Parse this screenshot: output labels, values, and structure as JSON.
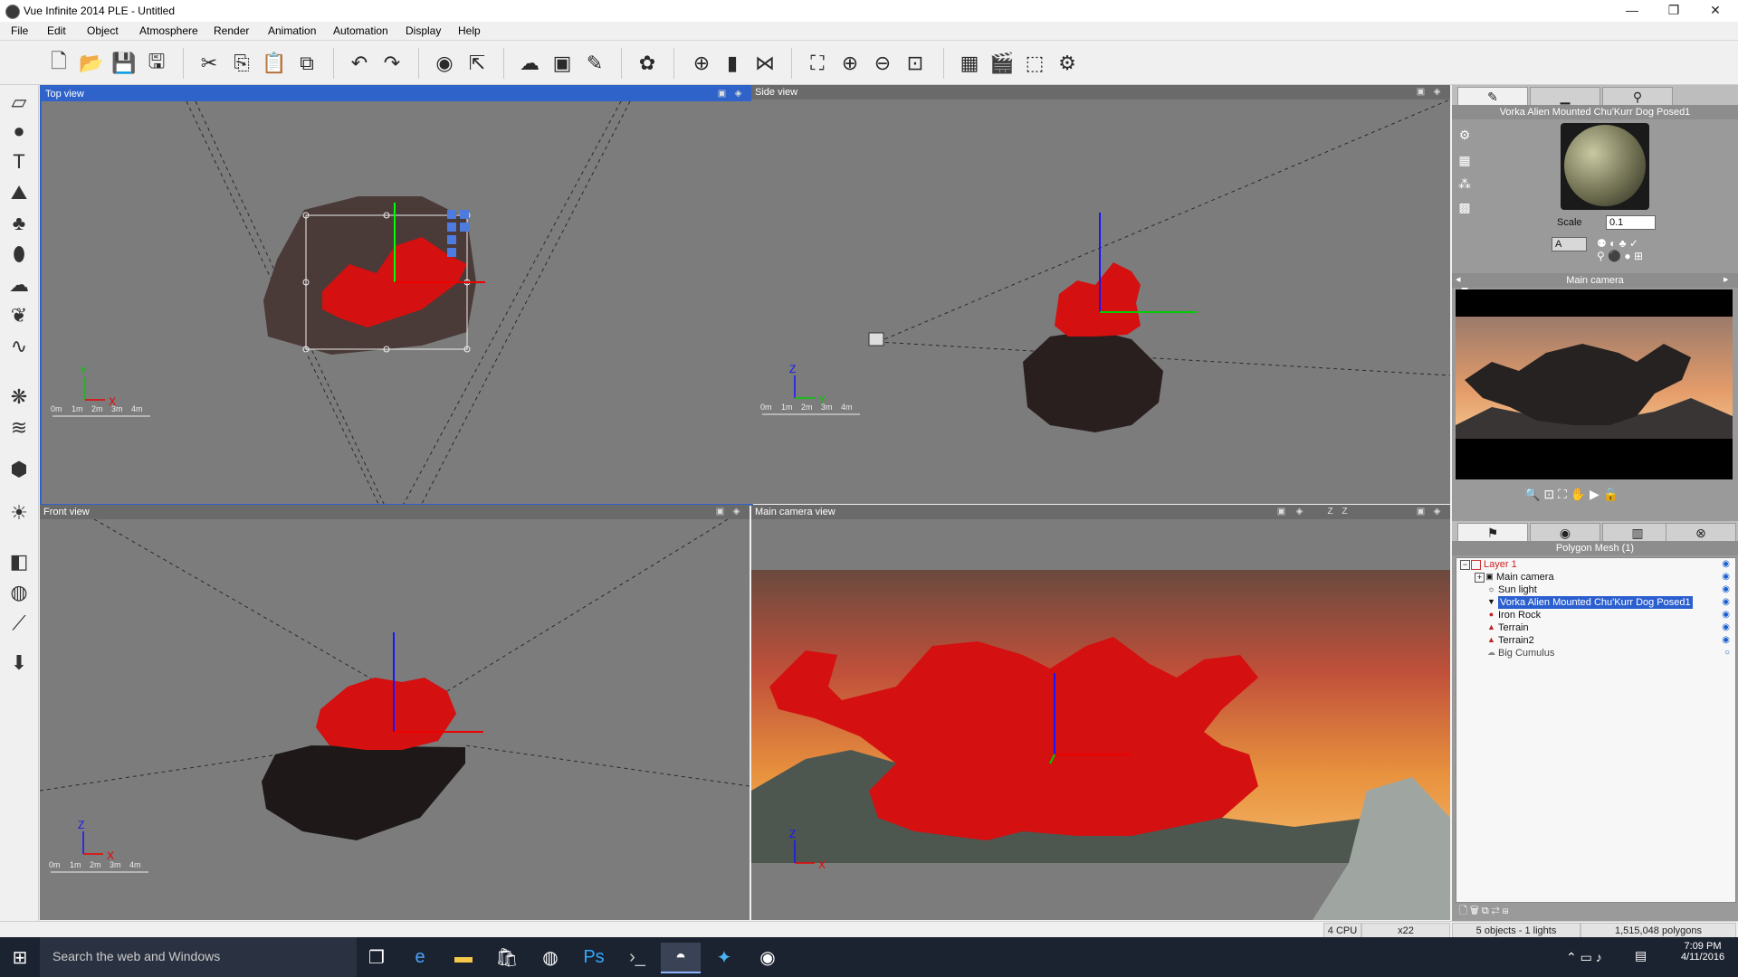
{
  "window": {
    "title": "Vue Infinite 2014 PLE - Untitled",
    "controls": [
      "—",
      "❐",
      "✕"
    ]
  },
  "menu": [
    "File",
    "Edit",
    "Object",
    "Atmosphere",
    "Render",
    "Animation",
    "Automation",
    "Display",
    "Help"
  ],
  "toolbar_icons": [
    "new-icon",
    "open-icon",
    "save-icon",
    "save-as-icon",
    "cut-icon",
    "copy-icon",
    "paste-icon",
    "duplicate-icon",
    "undo-icon",
    "redo-icon",
    "select-icon",
    "select-by-icon",
    "atmosphere-icon",
    "material-icon",
    "object-editor-icon",
    "color-icon",
    "link-icon",
    "chart-icon",
    "mirror-icon",
    "zoom-fit-icon",
    "zoom-in-icon",
    "zoom-out-icon",
    "frame-icon",
    "render-icon",
    "animation-icon",
    "full-screen-icon",
    "options-icon"
  ],
  "left_tools": [
    "plane-icon",
    "sphere-icon",
    "text-icon",
    "terrain-icon",
    "tree-icon",
    "rock-icon",
    "cloud-icon",
    "plant-icon",
    "path-icon",
    "ecosystem-icon",
    "wind-icon",
    "import-object-icon",
    "light-icon",
    "boolean-icon",
    "metablob-icon",
    "bone-icon",
    "load-object-icon"
  ],
  "viewports": {
    "top": {
      "title": "Top view",
      "axes": [
        "Y",
        "X"
      ],
      "scale": [
        "0m",
        "1m",
        "2m",
        "3m",
        "4m"
      ]
    },
    "side": {
      "title": "Side view",
      "axes": [
        "Z",
        "Y"
      ],
      "scale": [
        "0m",
        "1m",
        "2m",
        "3m",
        "4m"
      ]
    },
    "front": {
      "title": "Front view",
      "axes": [
        "Z",
        "X"
      ],
      "scale": [
        "0m",
        "1m",
        "2m",
        "3m",
        "4m"
      ]
    },
    "camera": {
      "title": "Main camera view",
      "axes": [
        "Z",
        "X"
      ],
      "ctrl_labels": [
        "Z",
        "Z"
      ]
    }
  },
  "right_panel": {
    "tabs": [
      "✎",
      "▁",
      "⚲"
    ],
    "object_name": "Vorka Alien Mounted Chu'Kurr Dog Posed1",
    "scale_label": "Scale",
    "scale_value": "0.1",
    "mode_value": "A",
    "camera_header": "Main camera",
    "world_header": "Polygon Mesh (1)",
    "tree": [
      {
        "label": "Layer 1",
        "indent": 0,
        "type": "layer"
      },
      {
        "label": "Main camera",
        "indent": 1,
        "type": "camera"
      },
      {
        "label": "Sun light",
        "indent": 2,
        "type": "light"
      },
      {
        "label": "Vorka Alien Mounted Chu'Kurr Dog Posed1",
        "indent": 2,
        "type": "mesh",
        "selected": true
      },
      {
        "label": "Iron Rock",
        "indent": 2,
        "type": "rock"
      },
      {
        "label": "Terrain",
        "indent": 2,
        "type": "terrain"
      },
      {
        "label": "Terrain2",
        "indent": 2,
        "type": "terrain"
      },
      {
        "label": "Big Cumulus",
        "indent": 2,
        "type": "cloud"
      }
    ]
  },
  "status": {
    "cpu": "4 CPU",
    "zoom": "x22",
    "objects": "5 objects - 1 lights",
    "polygons": "1,515,048 polygons"
  },
  "taskbar": {
    "search_placeholder": "Search the web and Windows",
    "time": "7:09 PM",
    "date": "4/11/2016",
    "apps": [
      "task-view-icon",
      "edge-icon",
      "file-explorer-icon",
      "store-icon",
      "chrome-icon",
      "photoshop-icon",
      "terminal-icon",
      "vue-icon",
      "twitter-icon",
      "camera-icon"
    ]
  }
}
